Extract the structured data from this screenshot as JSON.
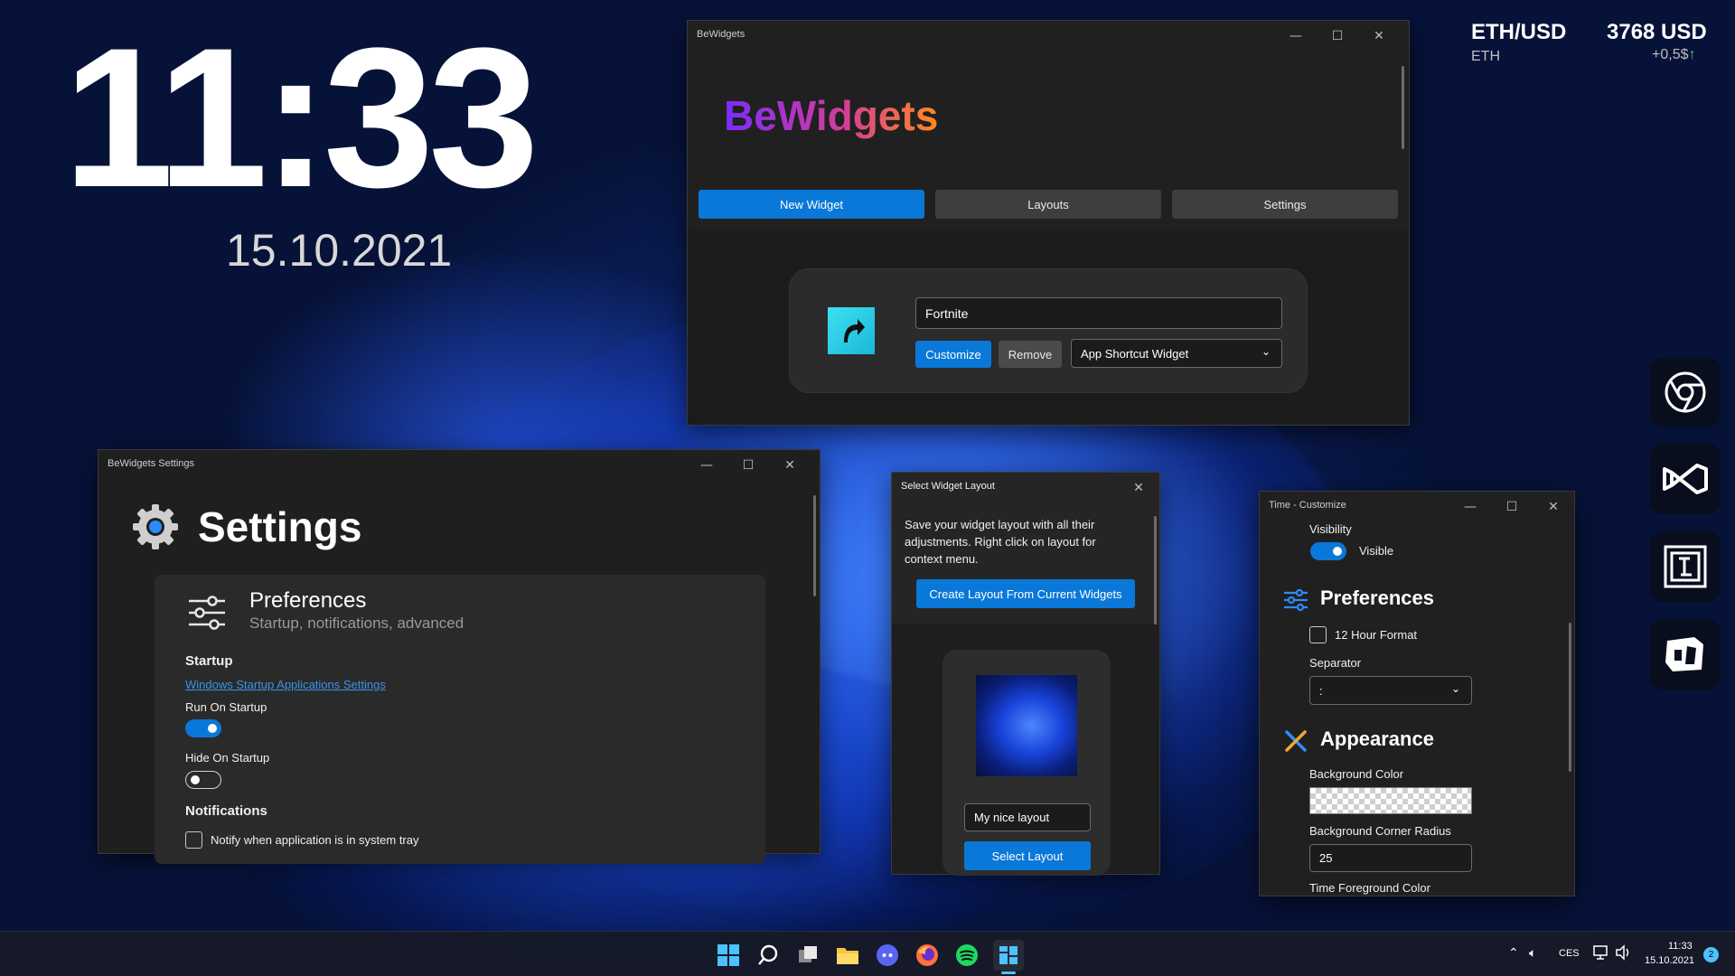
{
  "desktop": {
    "clock_time": "11:33",
    "clock_date": "15.10.2021",
    "crypto_pair": "ETH/USD",
    "crypto_symbol": "ETH",
    "crypto_price": "3768 USD",
    "crypto_change": "+0,5$",
    "crypto_up_color": "#3ad07a"
  },
  "main_window": {
    "title": "BeWidgets",
    "logo_text": "BeWidgets",
    "tabs": [
      "New Widget",
      "Layouts",
      "Settings"
    ],
    "widget_name": "Fortnite",
    "customize_label": "Customize",
    "remove_label": "Remove",
    "widget_type": "App Shortcut Widget"
  },
  "settings_window": {
    "title": "BeWidgets Settings",
    "heading": "Settings",
    "pref_title": "Preferences",
    "pref_subtitle": "Startup, notifications, advanced",
    "startup_heading": "Startup",
    "startup_link": "Windows Startup Applications Settings",
    "run_on_startup_label": "Run On Startup",
    "hide_on_startup_label": "Hide On Startup",
    "notifications_heading": "Notifications",
    "notify_label": "Notify when application is in system tray"
  },
  "layout_window": {
    "title": "Select Widget Layout",
    "description": "Save your widget layout with all their adjustments. Right click on layout for context menu.",
    "create_label": "Create Layout From Current Widgets",
    "layout_name": "My nice layout",
    "select_label": "Select Layout"
  },
  "customize_window": {
    "title": "Time - Customize",
    "visibility_label": "Visibility",
    "visible_label": "Visible",
    "preferences_heading": "Preferences",
    "hour_format_label": "12 Hour Format",
    "separator_label": "Separator",
    "separator_value": ":",
    "appearance_heading": "Appearance",
    "bg_color_label": "Background Color",
    "corner_radius_label": "Background Corner Radius",
    "corner_radius_value": "25",
    "fg_color_label": "Time Foreground Color"
  },
  "dock_icons": [
    "chrome-icon",
    "visual-studio-icon",
    "jetbrains-icon",
    "game-controller-icon"
  ],
  "taskbar": {
    "icons": [
      "windows-start-icon",
      "search-icon",
      "task-view-icon",
      "file-explorer-icon",
      "discord-icon",
      "firefox-icon",
      "spotify-icon",
      "bewidgets-icon"
    ],
    "language": "CES",
    "time": "11:33",
    "date": "15.10.2021",
    "notification_count": "2"
  }
}
